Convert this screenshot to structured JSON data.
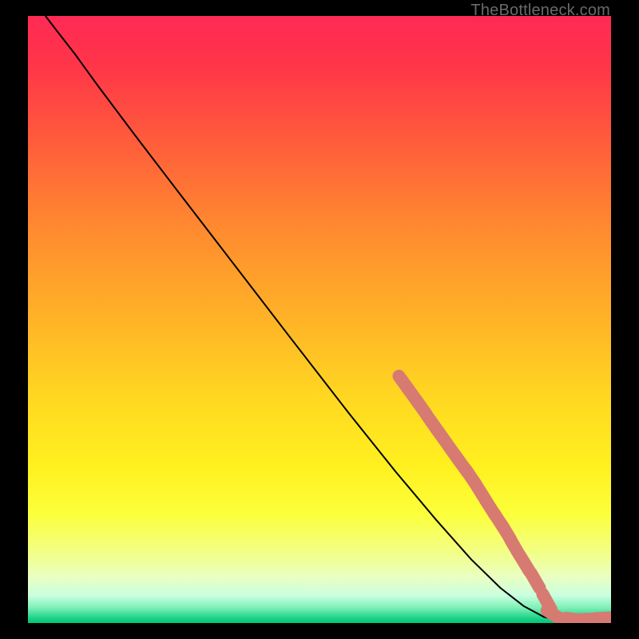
{
  "watermark": "TheBottleneck.com",
  "chart_data": {
    "type": "line",
    "title": "",
    "xlabel": "",
    "ylabel": "",
    "xlim": [
      0,
      100
    ],
    "ylim": [
      0,
      100
    ],
    "gradient_stops": [
      {
        "offset": 0.0,
        "color": "#ff2a55"
      },
      {
        "offset": 0.08,
        "color": "#ff3549"
      },
      {
        "offset": 0.2,
        "color": "#ff5a3c"
      },
      {
        "offset": 0.35,
        "color": "#ff8a2f"
      },
      {
        "offset": 0.5,
        "color": "#ffb327"
      },
      {
        "offset": 0.63,
        "color": "#ffd821"
      },
      {
        "offset": 0.74,
        "color": "#fff01f"
      },
      {
        "offset": 0.82,
        "color": "#fcff3a"
      },
      {
        "offset": 0.88,
        "color": "#f3ff82"
      },
      {
        "offset": 0.925,
        "color": "#e9ffc2"
      },
      {
        "offset": 0.955,
        "color": "#c9ffdf"
      },
      {
        "offset": 0.975,
        "color": "#7cf0b6"
      },
      {
        "offset": 0.993,
        "color": "#17d084"
      },
      {
        "offset": 1.0,
        "color": "#00c878"
      }
    ],
    "series": [
      {
        "name": "curve",
        "style": "line",
        "color": "#000000",
        "width": 2,
        "points": [
          {
            "x": 3.0,
            "y": 100.0
          },
          {
            "x": 5.0,
            "y": 97.5
          },
          {
            "x": 8.0,
            "y": 93.8
          },
          {
            "x": 12.0,
            "y": 88.5
          },
          {
            "x": 18.0,
            "y": 80.8
          },
          {
            "x": 25.0,
            "y": 72.0
          },
          {
            "x": 35.0,
            "y": 59.5
          },
          {
            "x": 45.0,
            "y": 47.0
          },
          {
            "x": 55.0,
            "y": 34.6
          },
          {
            "x": 63.0,
            "y": 25.0
          },
          {
            "x": 70.0,
            "y": 17.0
          },
          {
            "x": 76.0,
            "y": 10.5
          },
          {
            "x": 81.0,
            "y": 5.8
          },
          {
            "x": 85.0,
            "y": 2.8
          },
          {
            "x": 88.5,
            "y": 1.0
          },
          {
            "x": 91.0,
            "y": 0.5
          },
          {
            "x": 94.0,
            "y": 0.5
          },
          {
            "x": 97.0,
            "y": 0.5
          },
          {
            "x": 100.0,
            "y": 0.7
          }
        ]
      },
      {
        "name": "markers",
        "style": "points",
        "color": "#d77a72",
        "radius": 8,
        "points": [
          {
            "x": 64.5,
            "y": 39.5
          },
          {
            "x": 66.0,
            "y": 37.5
          },
          {
            "x": 67.5,
            "y": 35.5
          },
          {
            "x": 69.3,
            "y": 33.0
          },
          {
            "x": 71.0,
            "y": 30.7
          },
          {
            "x": 73.0,
            "y": 28.0
          },
          {
            "x": 74.5,
            "y": 26.0
          },
          {
            "x": 76.0,
            "y": 24.0
          },
          {
            "x": 77.8,
            "y": 21.3
          },
          {
            "x": 79.3,
            "y": 19.0
          },
          {
            "x": 80.8,
            "y": 16.8
          },
          {
            "x": 82.0,
            "y": 15.0
          },
          {
            "x": 83.5,
            "y": 12.5
          },
          {
            "x": 85.2,
            "y": 9.8
          },
          {
            "x": 87.0,
            "y": 7.0
          },
          {
            "x": 89.0,
            "y": 3.5
          },
          {
            "x": 90.3,
            "y": 1.3
          },
          {
            "x": 93.8,
            "y": 0.6
          },
          {
            "x": 95.5,
            "y": 0.6
          },
          {
            "x": 98.8,
            "y": 0.8
          },
          {
            "x": 100.0,
            "y": 0.8
          }
        ]
      }
    ]
  }
}
